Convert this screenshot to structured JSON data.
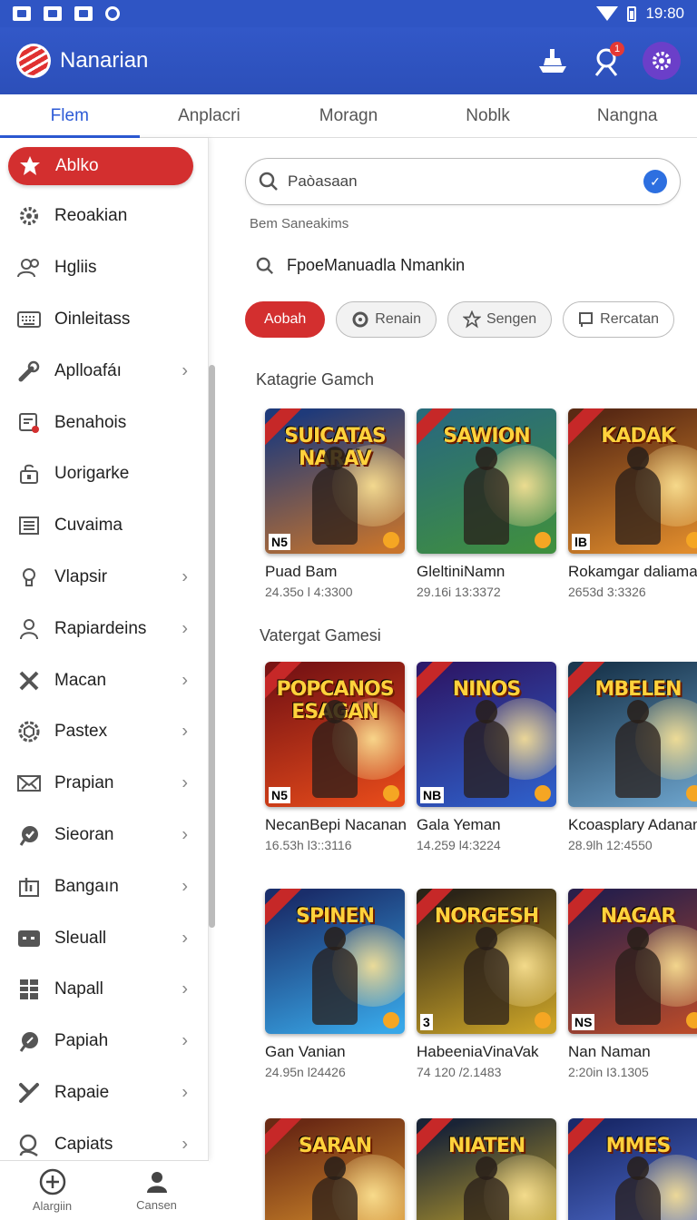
{
  "status": {
    "time": "19:80"
  },
  "app": {
    "title": "Nanarian",
    "notif_count": "1"
  },
  "tabs": [
    {
      "label": "Flem"
    },
    {
      "label": "Anplacri"
    },
    {
      "label": "Moragn"
    },
    {
      "label": "Noblk"
    },
    {
      "label": "Nangna"
    }
  ],
  "drawer": {
    "items": [
      {
        "label": "Ablko",
        "icon": "star-badge-icon"
      },
      {
        "label": "Reoakian",
        "icon": "gear-icon"
      },
      {
        "label": "Hgliis",
        "icon": "users-icon"
      },
      {
        "label": "Oinleitass",
        "icon": "keyboard-icon"
      },
      {
        "label": "Aplloafáı",
        "icon": "wrench-icon"
      },
      {
        "label": "Benahois",
        "icon": "record-icon"
      },
      {
        "label": "Uorigarke",
        "icon": "lock-icon"
      },
      {
        "label": "Cuvaima",
        "icon": "list-icon"
      },
      {
        "label": "Vlapsir",
        "icon": "bulb-icon"
      },
      {
        "label": "Rapiardeins",
        "icon": "person-icon"
      },
      {
        "label": "Macan",
        "icon": "cross-icon"
      },
      {
        "label": "Pastex",
        "icon": "hex-gear-icon"
      },
      {
        "label": "Prapian",
        "icon": "mail-icon"
      },
      {
        "label": "Sieoran",
        "icon": "check-bubble-icon"
      },
      {
        "label": "Bangaın",
        "icon": "chart-box-icon"
      },
      {
        "label": "Sleuall",
        "icon": "message-icon"
      },
      {
        "label": "Napall",
        "icon": "grid-icon"
      },
      {
        "label": "Papiah",
        "icon": "pin-icon"
      },
      {
        "label": "Rapaie",
        "icon": "tools-icon"
      },
      {
        "label": "Capiats",
        "icon": "search-person-icon"
      }
    ]
  },
  "bottom_nav": [
    {
      "label": "Alargiin",
      "icon": "plus-circle-icon"
    },
    {
      "label": "Cansen",
      "icon": "person-icon"
    }
  ],
  "search": {
    "placeholder": "Paòasaan",
    "hint": "Bem Saneakims",
    "suggestion": "FpoeManuadla Nmankin"
  },
  "chips": [
    {
      "label": "Aobah"
    },
    {
      "label": "Renain"
    },
    {
      "label": "Sengen"
    },
    {
      "label": "Rercatan"
    }
  ],
  "sections": [
    {
      "title": "Katagrie Gamch",
      "cards": [
        {
          "art": "SUICATAS NARAV",
          "num": "N5",
          "name": "Puad Bam",
          "meta": "24.35o l 4:3300"
        },
        {
          "art": "SAWION",
          "num": "",
          "name": "GleltiniNamn",
          "meta": "29.16i 13:3372"
        },
        {
          "art": "KADAK",
          "num": "lB",
          "name": "Rokamgar daliamar",
          "meta": "2653d 3:3326"
        }
      ]
    },
    {
      "title": "Vatergat Gamesi",
      "cards": [
        {
          "art": "POPCANOS ESAGAN",
          "num": "N5",
          "name": "NecanBepi Nacanan",
          "meta": "16.53h l3::3116"
        },
        {
          "art": "NINOS",
          "num": "NB",
          "name": "Gala Yeman",
          "meta": "14.259 l4:3224"
        },
        {
          "art": "MBELEN",
          "num": "",
          "name": "Kcoasplary Adanano",
          "meta": "28.9lh 12:4550"
        }
      ]
    },
    {
      "title": "",
      "cards": [
        {
          "art": "SPINEN",
          "num": "",
          "name": "Gan Vanian",
          "meta": "24.95n l24426"
        },
        {
          "art": "NORGESH",
          "num": "3",
          "name": "HabeeniaVinaVak",
          "meta": "74 120 /2.1483"
        },
        {
          "art": "NAGAR",
          "num": "NS",
          "name": "Nan Naman",
          "meta": "2:20in I3.1305"
        }
      ]
    },
    {
      "title": "",
      "cards": [
        {
          "art": "SARAN",
          "num": "",
          "name": "",
          "meta": ""
        },
        {
          "art": "NIATEN",
          "num": "",
          "name": "",
          "meta": ""
        },
        {
          "art": "MMES",
          "num": "",
          "name": "",
          "meta": ""
        }
      ]
    }
  ]
}
